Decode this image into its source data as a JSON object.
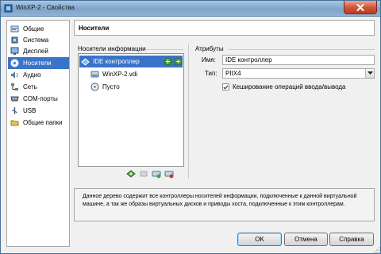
{
  "window": {
    "title": "WinXP-2 - Свойства"
  },
  "sidebar": {
    "items": [
      {
        "label": "Общие",
        "icon": "general-settings-icon"
      },
      {
        "label": "Система",
        "icon": "system-chip-icon"
      },
      {
        "label": "Дисплей",
        "icon": "display-monitor-icon"
      },
      {
        "label": "Носители",
        "icon": "storage-disk-icon",
        "selected": true
      },
      {
        "label": "Аудио",
        "icon": "audio-speaker-icon"
      },
      {
        "label": "Сеть",
        "icon": "network-icon"
      },
      {
        "label": "COM-порты",
        "icon": "serial-port-icon"
      },
      {
        "label": "USB",
        "icon": "usb-icon"
      },
      {
        "label": "Общие папки",
        "icon": "shared-folder-icon"
      }
    ]
  },
  "page": {
    "title": "Носители"
  },
  "storage_tree": {
    "label": "Носители информации",
    "items": [
      {
        "label": "IDE контроллер",
        "type": "controller",
        "selected": true
      },
      {
        "label": "WinXP-2.vdi",
        "type": "hard-disk"
      },
      {
        "label": "Пусто",
        "type": "empty-drive"
      }
    ]
  },
  "attributes": {
    "label": "Атрибуты",
    "name_label": "Имя:",
    "name_value": "IDE контроллер",
    "type_label": "Тип:",
    "type_value": "PIIX4",
    "cache_label": "Кеширование операций ввода/вывода",
    "cache_checked": true
  },
  "info": {
    "text": "Данное дерево содержит все контроллеры носителей информации, подключенные к данной виртуальной машине, а так же образы виртуальных дисков и приводы хоста, подключенные к этим контроллерам."
  },
  "buttons": {
    "ok": "OK",
    "cancel": "Отмена",
    "help": "Справка"
  },
  "colors": {
    "selection": "#3a74c9",
    "titlebar": "#8fb2d6",
    "close": "#c03a20"
  }
}
